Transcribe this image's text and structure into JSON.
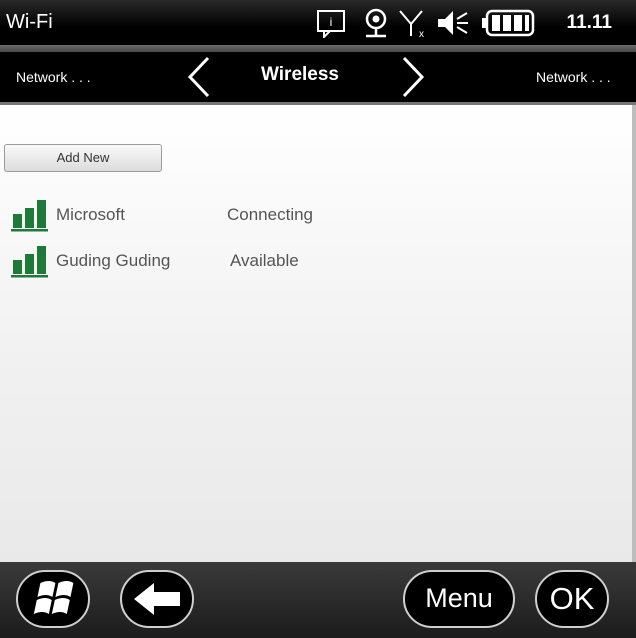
{
  "status_bar": {
    "title": "Wi-Fi",
    "time": "11.11",
    "icons": [
      "notification-icon",
      "location-icon",
      "no-signal-icon",
      "volume-icon",
      "battery-icon"
    ]
  },
  "nav": {
    "left_label": "Network . . .",
    "title": "Wireless",
    "right_label": "Network . . ."
  },
  "content": {
    "add_new_label": "Add New",
    "networks": [
      {
        "name": "Microsoft",
        "status": "Connecting"
      },
      {
        "name": "Guding Guding",
        "status": "Available"
      }
    ],
    "accent_color": "#1f7a3a"
  },
  "bottom_bar": {
    "start_icon": "windows-logo-icon",
    "back_icon": "back-arrow-icon",
    "menu_label": "Menu",
    "ok_label": "OK"
  }
}
